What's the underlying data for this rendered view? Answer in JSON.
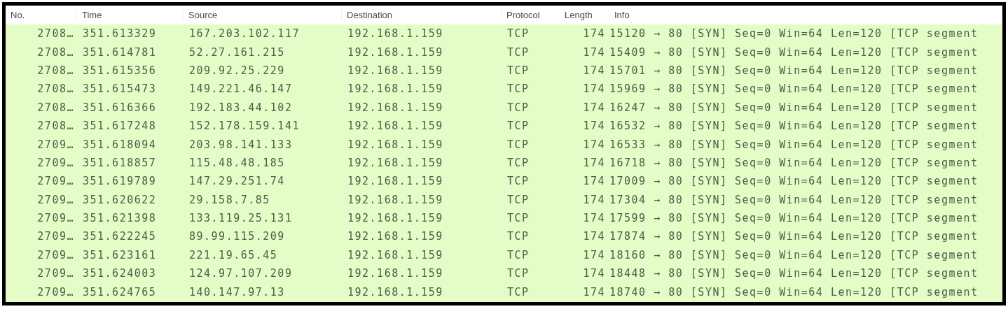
{
  "table": {
    "columns": [
      "No.",
      "Time",
      "Source",
      "Destination",
      "Protocol",
      "Length",
      "Info"
    ],
    "rows": [
      {
        "no": "2708…",
        "time": "351.613329",
        "source": "167.203.102.117",
        "destination": "192.168.1.159",
        "protocol": "TCP",
        "length": "174",
        "info": "15120 → 80 [SYN] Seq=0 Win=64 Len=120 [TCP segment"
      },
      {
        "no": "2708…",
        "time": "351.614781",
        "source": "52.27.161.215",
        "destination": "192.168.1.159",
        "protocol": "TCP",
        "length": "174",
        "info": "15409 → 80 [SYN] Seq=0 Win=64 Len=120 [TCP segment"
      },
      {
        "no": "2708…",
        "time": "351.615356",
        "source": "209.92.25.229",
        "destination": "192.168.1.159",
        "protocol": "TCP",
        "length": "174",
        "info": "15701 → 80 [SYN] Seq=0 Win=64 Len=120 [TCP segment"
      },
      {
        "no": "2708…",
        "time": "351.615473",
        "source": "149.221.46.147",
        "destination": "192.168.1.159",
        "protocol": "TCP",
        "length": "174",
        "info": "15969 → 80 [SYN] Seq=0 Win=64 Len=120 [TCP segment"
      },
      {
        "no": "2708…",
        "time": "351.616366",
        "source": "192.183.44.102",
        "destination": "192.168.1.159",
        "protocol": "TCP",
        "length": "174",
        "info": "16247 → 80 [SYN] Seq=0 Win=64 Len=120 [TCP segment"
      },
      {
        "no": "2708…",
        "time": "351.617248",
        "source": "152.178.159.141",
        "destination": "192.168.1.159",
        "protocol": "TCP",
        "length": "174",
        "info": "16532 → 80 [SYN] Seq=0 Win=64 Len=120 [TCP segment"
      },
      {
        "no": "2709…",
        "time": "351.618094",
        "source": "203.98.141.133",
        "destination": "192.168.1.159",
        "protocol": "TCP",
        "length": "174",
        "info": "16533 → 80 [SYN] Seq=0 Win=64 Len=120 [TCP segment"
      },
      {
        "no": "2709…",
        "time": "351.618857",
        "source": "115.48.48.185",
        "destination": "192.168.1.159",
        "protocol": "TCP",
        "length": "174",
        "info": "16718 → 80 [SYN] Seq=0 Win=64 Len=120 [TCP segment"
      },
      {
        "no": "2709…",
        "time": "351.619789",
        "source": "147.29.251.74",
        "destination": "192.168.1.159",
        "protocol": "TCP",
        "length": "174",
        "info": "17009 → 80 [SYN] Seq=0 Win=64 Len=120 [TCP segment"
      },
      {
        "no": "2709…",
        "time": "351.620622",
        "source": "29.158.7.85",
        "destination": "192.168.1.159",
        "protocol": "TCP",
        "length": "174",
        "info": "17304 → 80 [SYN] Seq=0 Win=64 Len=120 [TCP segment"
      },
      {
        "no": "2709…",
        "time": "351.621398",
        "source": "133.119.25.131",
        "destination": "192.168.1.159",
        "protocol": "TCP",
        "length": "174",
        "info": "17599 → 80 [SYN] Seq=0 Win=64 Len=120 [TCP segment"
      },
      {
        "no": "2709…",
        "time": "351.622245",
        "source": "89.99.115.209",
        "destination": "192.168.1.159",
        "protocol": "TCP",
        "length": "174",
        "info": "17874 → 80 [SYN] Seq=0 Win=64 Len=120 [TCP segment"
      },
      {
        "no": "2709…",
        "time": "351.623161",
        "source": "221.19.65.45",
        "destination": "192.168.1.159",
        "protocol": "TCP",
        "length": "174",
        "info": "18160 → 80 [SYN] Seq=0 Win=64 Len=120 [TCP segment"
      },
      {
        "no": "2709…",
        "time": "351.624003",
        "source": "124.97.107.209",
        "destination": "192.168.1.159",
        "protocol": "TCP",
        "length": "174",
        "info": "18448 → 80 [SYN] Seq=0 Win=64 Len=120 [TCP segment"
      },
      {
        "no": "2709…",
        "time": "351.624765",
        "source": "140.147.97.13",
        "destination": "192.168.1.159",
        "protocol": "TCP",
        "length": "174",
        "info": "18740 → 80 [SYN] Seq=0 Win=64 Len=120 [TCP segment"
      }
    ]
  }
}
